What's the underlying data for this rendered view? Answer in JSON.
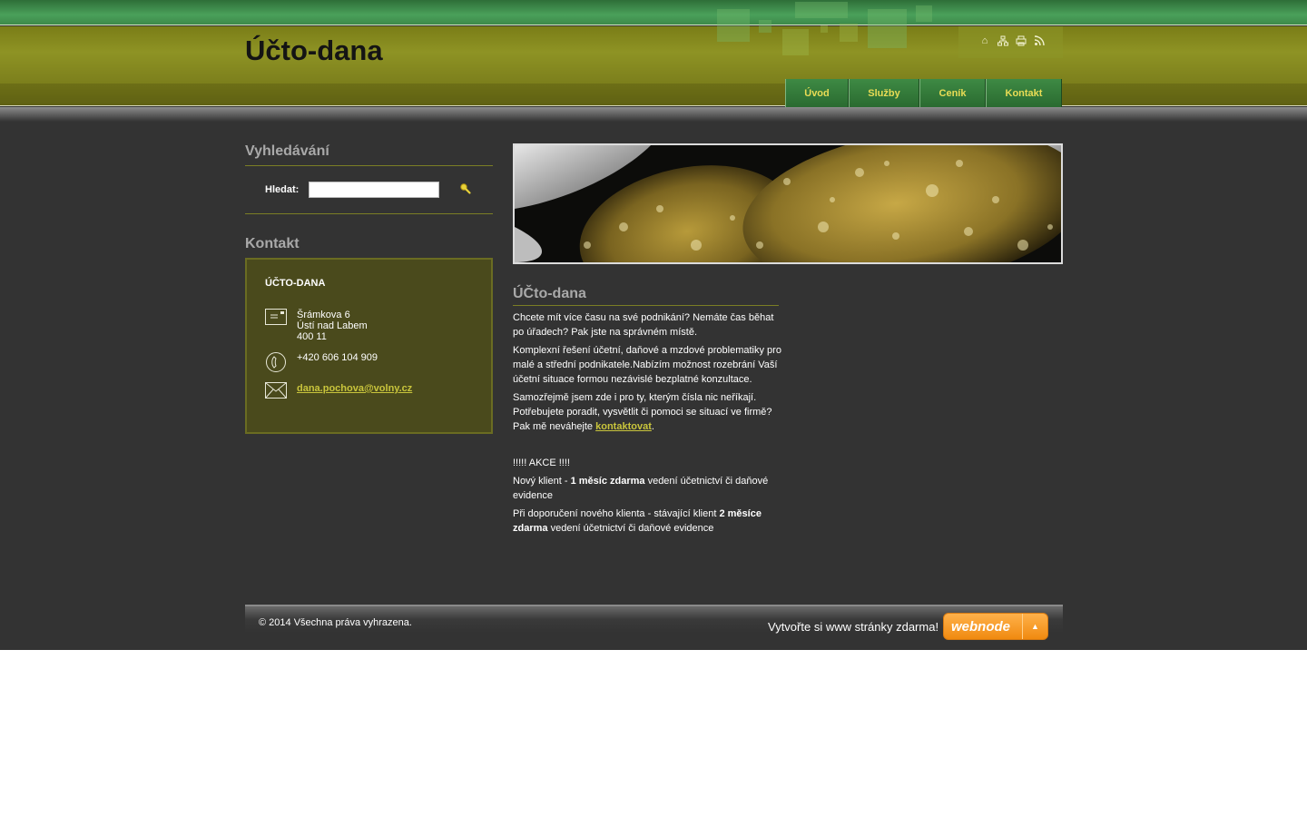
{
  "header": {
    "site_title": "Účto-dana",
    "tools": [
      "home-icon",
      "sitemap-icon",
      "print-icon",
      "rss-icon"
    ]
  },
  "nav": {
    "items": [
      {
        "label": "Úvod"
      },
      {
        "label": "Služby"
      },
      {
        "label": "Ceník"
      },
      {
        "label": "Kontakt"
      }
    ]
  },
  "sidebar": {
    "search": {
      "heading": "Vyhledávání",
      "label": "Hledat:",
      "value": "",
      "button_icon": "search-icon"
    },
    "contact": {
      "heading": "Kontakt",
      "name": "ÚČTO-DANA",
      "address_lines": [
        "Šrámkova 6",
        "Ústí nad Labem",
        "400 11"
      ],
      "phone": "+420 606 104 909",
      "email": "dana.pochova@volny.cz"
    }
  },
  "main": {
    "heading": "ÚČto-dana",
    "p1": "Chcete mít více času na své podnikání? Nemáte čas běhat po úřadech? Pak jste na správném místě.",
    "p2": "Komplexní řešení účetní, daňové a mzdové problematiky pro malé a střední podnikatele.Nabízím možnost rozebrání Vaší účetní situace formou nezávislé bezplatné konzultace.",
    "p3_before": "Samozřejmě jsem zde i pro ty, kterým čísla nic neříkají. Potřebujete poradit, vysvětlit či pomoci se situací ve firmě? Pak mě neváhejte ",
    "p3_link": "kontaktovat",
    "p3_after": ".",
    "akce": " !!!!! AKCE !!!!",
    "offer1_before": "Nový klient - ",
    "offer1_bold": "1 měsíc zdarma",
    "offer1_after": " vedení účetnictví či daňové evidence",
    "offer2_before": "Při doporučení nového klienta - stávající klient ",
    "offer2_bold": "2 měsíce zdarma",
    "offer2_after": " vedení účetnictví či daňové evidence"
  },
  "footer": {
    "copyright": "© 2014 Všechna práva vyhrazena.",
    "promo": "Vytvořte si www stránky zdarma!",
    "webnode_label": "webnode"
  },
  "colors": {
    "accent_link": "#c9c53c",
    "nav_text": "#e9dc55",
    "header_olive": "#8e9324",
    "nav_green": "#3e8a44",
    "body_bg": "#333333"
  }
}
